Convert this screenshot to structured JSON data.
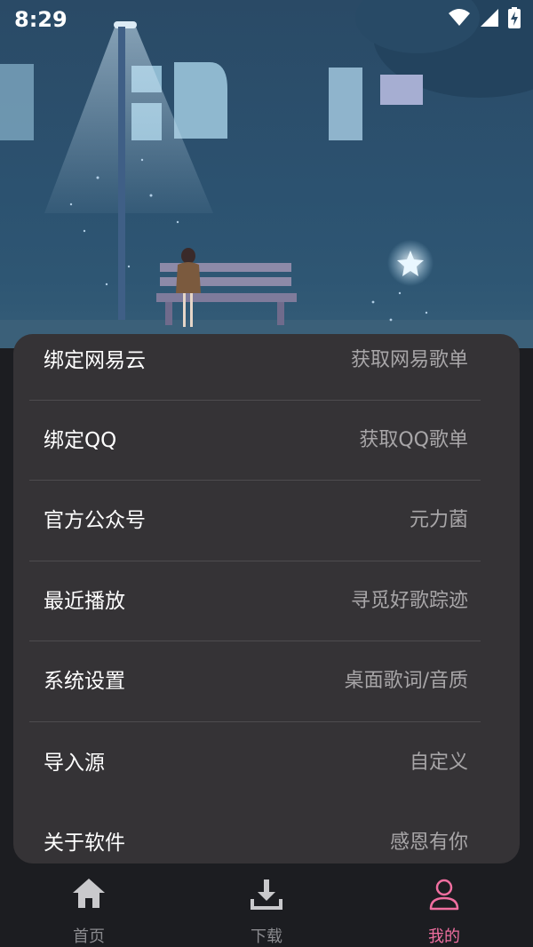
{
  "status_bar": {
    "time": "8:29"
  },
  "menu": [
    {
      "label": "绑定网易云",
      "value": "获取网易歌单"
    },
    {
      "label": "绑定QQ",
      "value": "获取QQ歌单"
    },
    {
      "label": "官方公众号",
      "value": "元力菌"
    },
    {
      "label": "最近播放",
      "value": "寻觅好歌踪迹"
    },
    {
      "label": "系统设置",
      "value": "桌面歌词/音质"
    },
    {
      "label": "导入源",
      "value": "自定义"
    },
    {
      "label": "关于软件",
      "value": "感恩有你"
    }
  ],
  "tabs": [
    {
      "label": "首页",
      "icon": "home-icon",
      "active": false
    },
    {
      "label": "下载",
      "icon": "download-icon",
      "active": false
    },
    {
      "label": "我的",
      "icon": "user-icon",
      "active": true
    }
  ],
  "colors": {
    "accent": "#f06fa0",
    "panel": "#353336",
    "background": "#1c1d21"
  }
}
